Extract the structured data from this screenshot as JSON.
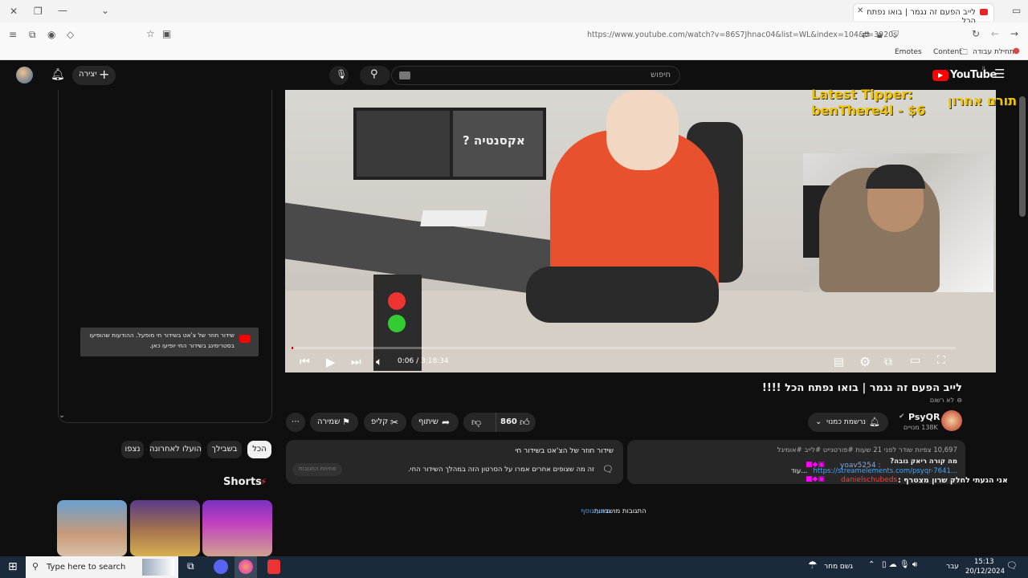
{
  "browser": {
    "tab_title": "לייב הפעם זה נגמר | בואו נפתח הכל",
    "url": "https://www.youtube.com/watch?v=86S7Jhnac04&list=WL&index=104&t=3920s",
    "bookmarks": [
      "Emotes",
      "Content",
      "תחילת עבודה"
    ]
  },
  "youtube": {
    "logo": "YouTube",
    "logo_region": "IL",
    "search_placeholder": "חיפוש",
    "create_label": "יצירה"
  },
  "video": {
    "overlay_word": "אקסנטיה ?",
    "latest_tipper_label": "Latest Tipper:",
    "latest_tipper_value": "benThere4l - $6",
    "latest_tipper_he": "תורם אחרון",
    "time": "0:06 / 3:18:34",
    "progress": 0.001
  },
  "chat": {
    "notice_line1": "שידור חוזר של צ'אט בשידור חי מופעל. ההודעות שהופיעו",
    "notice_line2": "בסטרימינג בשידור החי יופיעו כאן."
  },
  "chips": [
    "הכל",
    "בשבילך",
    "הועלו לאחרונה",
    "נצפו"
  ],
  "shorts_label": "Shorts",
  "info": {
    "title": "לייב הפעם זה נגמר | בואו נפתח הכל !!!!",
    "unlisted": "לא רשום",
    "channel": "PsyQR",
    "subs": "138K מנויים",
    "subscribe": "נרשמת כמנוי",
    "likes": "860",
    "share": "שיתוף",
    "clip": "קליפ",
    "save": "שמירה",
    "views_line": "10,697 צפיות  שודר לפני 21 שעות  #פורטנייט #לייב #אומיגל",
    "desc_line1": "מה קורה ריאק גובה?",
    "desc_link": "https://streamelements.com/psyqr-7641...",
    "desc_more": "...עוד",
    "overlay_line": "אני הגעתי לחלק שרון מצטרף :",
    "overlay_user1": "yoav5254 :",
    "overlay_user2": "danielschubeds",
    "replay_title": "שידור חוזר של הצ'אט בשידור חי",
    "replay_text": "זה מה שצופים אחרים אמרו על הסרטון הזה במהלך השידור החי.",
    "replay_btn": "פתיחת התגובות",
    "comments_off": "התגובות מושבתות.",
    "more_info": "מידע נוסף"
  },
  "taskbar": {
    "search": "Type here to search",
    "weather": "גשם מחר",
    "lang": "עבר",
    "time": "15:13",
    "date": "20/12/2024"
  }
}
